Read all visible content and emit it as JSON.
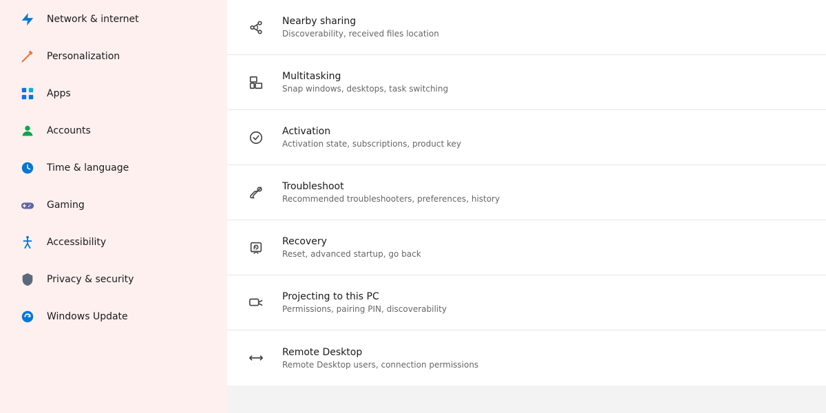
{
  "sidebar": {
    "items": [
      {
        "id": "network",
        "label": "Network & internet",
        "icon": "🌐",
        "icon_name": "network-icon"
      },
      {
        "id": "personalization",
        "label": "Personalization",
        "icon": "✏️",
        "icon_name": "personalization-icon"
      },
      {
        "id": "apps",
        "label": "Apps",
        "icon": "🟦",
        "icon_name": "apps-icon"
      },
      {
        "id": "accounts",
        "label": "Accounts",
        "icon": "👤",
        "icon_name": "accounts-icon"
      },
      {
        "id": "time",
        "label": "Time & language",
        "icon": "🌍",
        "icon_name": "time-icon"
      },
      {
        "id": "gaming",
        "label": "Gaming",
        "icon": "🎮",
        "icon_name": "gaming-icon"
      },
      {
        "id": "accessibility",
        "label": "Accessibility",
        "icon": "♿",
        "icon_name": "accessibility-icon"
      },
      {
        "id": "privacy",
        "label": "Privacy & security",
        "icon": "🛡️",
        "icon_name": "privacy-icon"
      },
      {
        "id": "update",
        "label": "Windows Update",
        "icon": "🔄",
        "icon_name": "update-icon"
      }
    ]
  },
  "settings": {
    "items": [
      {
        "id": "nearby-sharing",
        "title": "Nearby sharing",
        "desc": "Discoverability, received files location",
        "icon_name": "nearby-sharing-icon"
      },
      {
        "id": "multitasking",
        "title": "Multitasking",
        "desc": "Snap windows, desktops, task switching",
        "icon_name": "multitasking-icon"
      },
      {
        "id": "activation",
        "title": "Activation",
        "desc": "Activation state, subscriptions, product key",
        "icon_name": "activation-icon"
      },
      {
        "id": "troubleshoot",
        "title": "Troubleshoot",
        "desc": "Recommended troubleshooters, preferences, history",
        "icon_name": "troubleshoot-icon"
      },
      {
        "id": "recovery",
        "title": "Recovery",
        "desc": "Reset, advanced startup, go back",
        "icon_name": "recovery-icon"
      },
      {
        "id": "projecting",
        "title": "Projecting to this PC",
        "desc": "Permissions, pairing PIN, discoverability",
        "icon_name": "projecting-icon"
      },
      {
        "id": "remote-desktop",
        "title": "Remote Desktop",
        "desc": "Remote Desktop users, connection permissions",
        "icon_name": "remote-desktop-icon"
      }
    ]
  }
}
